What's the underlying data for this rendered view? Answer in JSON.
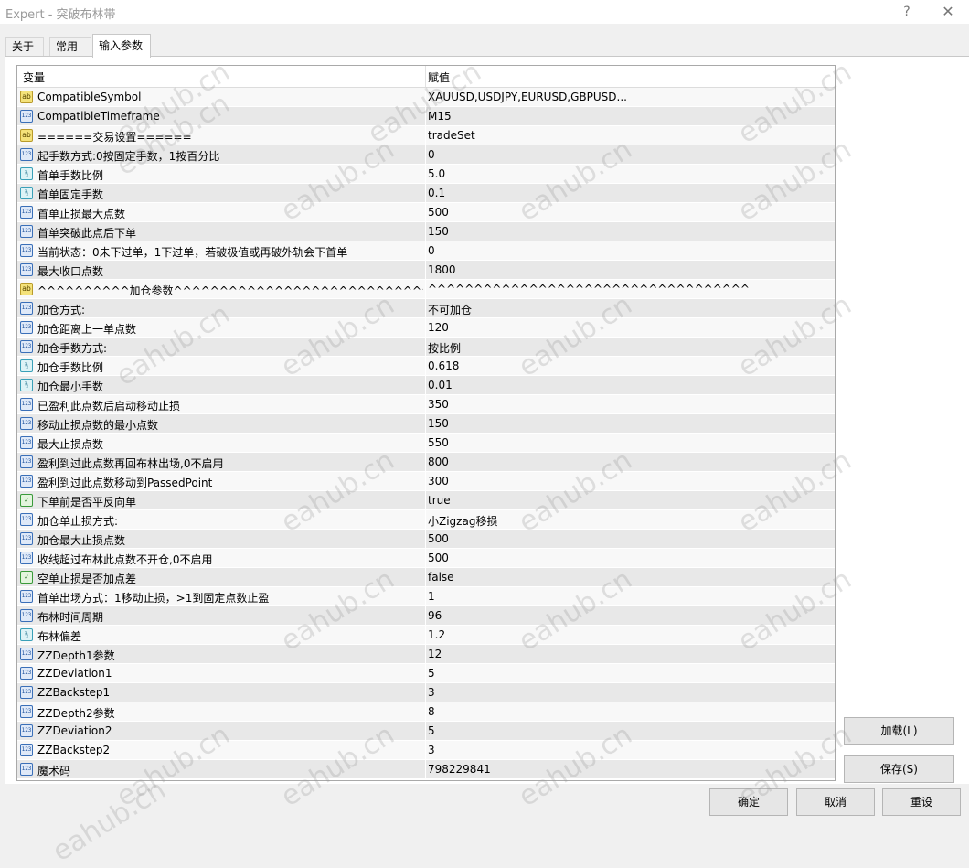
{
  "window": {
    "title": "Expert - 突破布林带",
    "help": "?",
    "close": "✕"
  },
  "tabs": [
    {
      "label": "关于"
    },
    {
      "label": "常用"
    },
    {
      "label": "输入参数"
    }
  ],
  "table": {
    "col_variable": "变量",
    "col_value": "赋值",
    "rows": [
      {
        "icon": "ab",
        "name": "CompatibleSymbol",
        "value": "XAUUSD,USDJPY,EURUSD,GBPUSD..."
      },
      {
        "icon": "123",
        "name": "CompatibleTimeframe",
        "value": "M15"
      },
      {
        "icon": "ab",
        "name": "======交易设置======",
        "value": "tradeSet"
      },
      {
        "icon": "123",
        "name": "起手数方式:0按固定手数，1按百分比",
        "value": "0"
      },
      {
        "icon": "v2",
        "name": "首单手数比例",
        "value": "5.0"
      },
      {
        "icon": "v2",
        "name": "首单固定手数",
        "value": "0.1"
      },
      {
        "icon": "123",
        "name": "首单止损最大点数",
        "value": "500"
      },
      {
        "icon": "123",
        "name": "首单突破此点后下单",
        "value": "150"
      },
      {
        "icon": "123",
        "name": "当前状态：0未下过单，1下过单，若破极值或再破外轨会下首单",
        "value": "0"
      },
      {
        "icon": "123",
        "name": "最大收口点数",
        "value": "1800"
      },
      {
        "icon": "ab",
        "name": "^^^^^^^^^^加仓参数^^^^^^^^^^^^^^^^^^^^^^^^^^^^^^^^...",
        "value": "^^^^^^^^^^^^^^^^^^^^^^^^^^^^^^^^^^^"
      },
      {
        "icon": "123",
        "name": "加仓方式:",
        "value": "不可加仓"
      },
      {
        "icon": "123",
        "name": "加仓距离上一单点数",
        "value": "120"
      },
      {
        "icon": "123",
        "name": "加仓手数方式:",
        "value": "按比例"
      },
      {
        "icon": "v2",
        "name": "加仓手数比例",
        "value": "0.618"
      },
      {
        "icon": "v2",
        "name": "加仓最小手数",
        "value": "0.01"
      },
      {
        "icon": "123",
        "name": "已盈利此点数后启动移动止损",
        "value": "350"
      },
      {
        "icon": "123",
        "name": "移动止损点数的最小点数",
        "value": "150"
      },
      {
        "icon": "123",
        "name": "最大止损点数",
        "value": "550"
      },
      {
        "icon": "123",
        "name": "盈利到过此点数再回布林出场,0不启用",
        "value": "800"
      },
      {
        "icon": "123",
        "name": "盈利到过此点数移动到PassedPoint",
        "value": "300"
      },
      {
        "icon": "bool",
        "name": "下单前是否平反向单",
        "value": "true"
      },
      {
        "icon": "123",
        "name": "加仓单止损方式:",
        "value": "小Zigzag移损"
      },
      {
        "icon": "123",
        "name": "加仓最大止损点数",
        "value": "500"
      },
      {
        "icon": "123",
        "name": "收线超过布林此点数不开仓,0不启用",
        "value": "500"
      },
      {
        "icon": "bool",
        "name": "空单止损是否加点差",
        "value": "false"
      },
      {
        "icon": "123",
        "name": "首单出场方式：1移动止损，>1到固定点数止盈",
        "value": "1"
      },
      {
        "icon": "123",
        "name": "布林时间周期",
        "value": "96"
      },
      {
        "icon": "v2",
        "name": "布林偏差",
        "value": "1.2"
      },
      {
        "icon": "123",
        "name": "ZZDepth1参数",
        "value": "12"
      },
      {
        "icon": "123",
        "name": "ZZDeviation1",
        "value": "5"
      },
      {
        "icon": "123",
        "name": "ZZBackstep1",
        "value": "3"
      },
      {
        "icon": "123",
        "name": "ZZDepth2参数",
        "value": "8"
      },
      {
        "icon": "123",
        "name": "ZZDeviation2",
        "value": "5"
      },
      {
        "icon": "123",
        "name": "ZZBackstep2",
        "value": "3"
      },
      {
        "icon": "123",
        "name": "魔术码",
        "value": "798229841"
      }
    ]
  },
  "icon_glyphs": {
    "ab": "ab",
    "123": "123",
    "v2": "½",
    "bool": "✓"
  },
  "buttons": {
    "load": "加载(L)",
    "save": "保存(S)",
    "ok": "确定",
    "cancel": "取消",
    "reset": "重设"
  },
  "watermark": "eahub.cn"
}
